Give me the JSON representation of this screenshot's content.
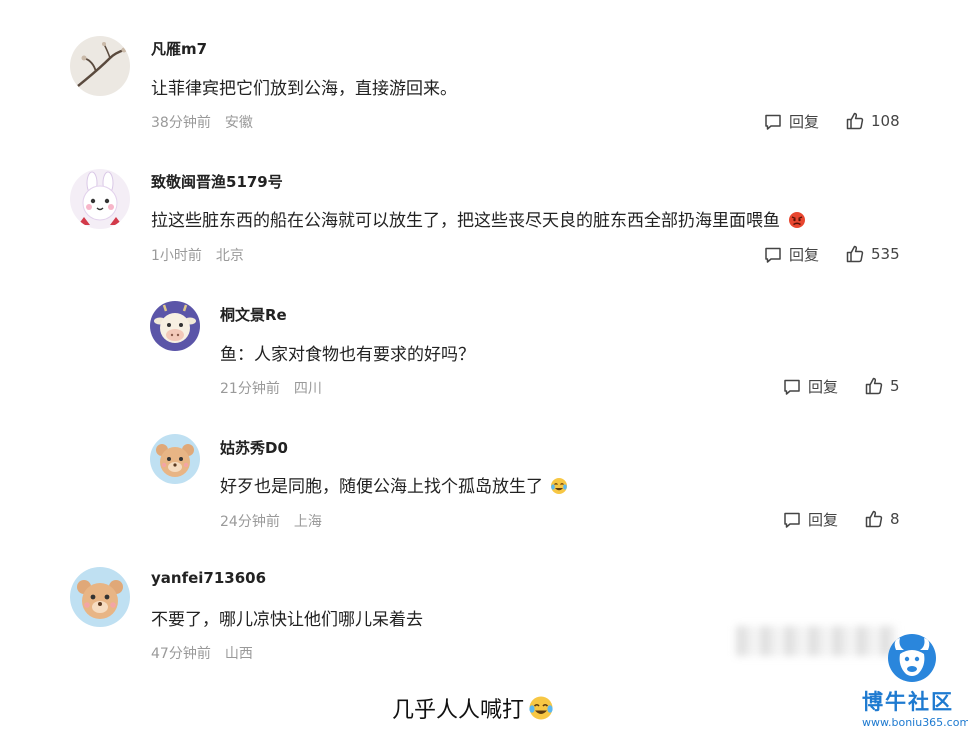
{
  "comments": [
    {
      "username": "凡雁m7",
      "text": "让菲律宾把它们放到公海，直接游回来。",
      "time": "38分钟前",
      "location": "安徽",
      "reply_label": "回复",
      "likes": "108"
    },
    {
      "username": "致敬闽晋渔5179号",
      "text": "拉这些脏东西的船在公海就可以放生了，把这些丧尽天良的脏东西全部扔海里面喂鱼",
      "time": "1小时前",
      "location": "北京",
      "reply_label": "回复",
      "likes": "535",
      "replies": [
        {
          "username": "桐文景Re",
          "text": "鱼：人家对食物也有要求的好吗？",
          "time": "21分钟前",
          "location": "四川",
          "reply_label": "回复",
          "likes": "5"
        },
        {
          "username": "姑苏秀D0",
          "text": "好歹也是同胞，随便公海上找个孤岛放生了",
          "time": "24分钟前",
          "location": "上海",
          "reply_label": "回复",
          "likes": "8"
        }
      ]
    },
    {
      "username": "yanfei713606",
      "text": "不要了，哪儿凉快让他们哪儿呆着去",
      "time": "47分钟前",
      "location": "山西"
    }
  ],
  "caption": "几乎人人喊打",
  "watermark": {
    "title": "博牛社区",
    "url": "www.boniu365.com"
  },
  "icons": {
    "reply": "speech-bubble-icon",
    "like": "thumbs-up-icon"
  }
}
